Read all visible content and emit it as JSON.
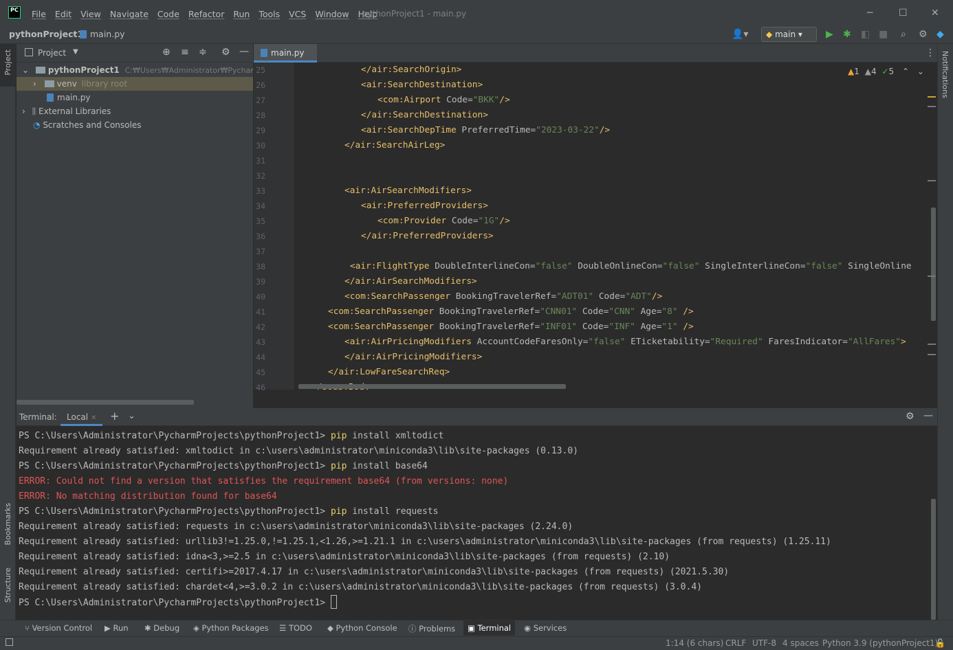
{
  "app": {
    "title": "pythonProject1 - main.py"
  },
  "menu": [
    "File",
    "Edit",
    "View",
    "Navigate",
    "Code",
    "Refactor",
    "Run",
    "Tools",
    "VCS",
    "Window",
    "Help"
  ],
  "breadcrumb": {
    "project": "pythonProject1",
    "file": "main.py"
  },
  "run_config": "main",
  "project_panel": {
    "title": "Project",
    "tree": [
      {
        "label": "pythonProject1",
        "note": "C:₩Users₩Administrator₩PycharmProj"
      },
      {
        "label": "venv",
        "note": "library root"
      },
      {
        "label": "main.py",
        "note": ""
      },
      {
        "label": "External Libraries",
        "note": ""
      },
      {
        "label": "Scratches and Consoles",
        "note": ""
      }
    ]
  },
  "left_strip": {
    "project": "Project",
    "bookmarks": "Bookmarks",
    "structure": "Structure"
  },
  "right_strip": {
    "notifications": "Notifications"
  },
  "editor": {
    "tab": "main.py",
    "inspections": {
      "warn_a": "1",
      "warn_b": "4",
      "ok": "5"
    },
    "lines": [
      {
        "n": "25",
        "indent": 4,
        "parts": [
          [
            "t",
            "</air:SearchOrigin>"
          ]
        ]
      },
      {
        "n": "26",
        "indent": 4,
        "parts": [
          [
            "t",
            "<air:SearchDestination>"
          ]
        ]
      },
      {
        "n": "27",
        "indent": 5,
        "parts": [
          [
            "t",
            "<com:Airport "
          ],
          [
            "a",
            "Code="
          ],
          [
            "v",
            "\"BKK\""
          ],
          [
            "t",
            "/>"
          ]
        ]
      },
      {
        "n": "28",
        "indent": 4,
        "parts": [
          [
            "t",
            "</air:SearchDestination>"
          ]
        ]
      },
      {
        "n": "29",
        "indent": 4,
        "parts": [
          [
            "t",
            "<air:SearchDepTime "
          ],
          [
            "a",
            "PreferredTime="
          ],
          [
            "v",
            "\"2023-03-22\""
          ],
          [
            "t",
            "/>"
          ]
        ]
      },
      {
        "n": "30",
        "indent": 3,
        "parts": [
          [
            "t",
            "</air:SearchAirLeg>"
          ]
        ]
      },
      {
        "n": "31",
        "indent": 0,
        "parts": []
      },
      {
        "n": "32",
        "indent": 0,
        "parts": []
      },
      {
        "n": "33",
        "indent": 3,
        "parts": [
          [
            "t",
            "<air:AirSearchModifiers>"
          ]
        ]
      },
      {
        "n": "34",
        "indent": 4,
        "parts": [
          [
            "t",
            "<air:PreferredProviders>"
          ]
        ]
      },
      {
        "n": "35",
        "indent": 5,
        "parts": [
          [
            "t",
            "<com:Provider "
          ],
          [
            "a",
            "Code="
          ],
          [
            "v",
            "\"1G\""
          ],
          [
            "t",
            "/>"
          ]
        ]
      },
      {
        "n": "36",
        "indent": 4,
        "parts": [
          [
            "t",
            "</air:PreferredProviders>"
          ]
        ]
      },
      {
        "n": "37",
        "indent": 0,
        "parts": []
      },
      {
        "n": "38",
        "indent": 3.33,
        "parts": [
          [
            "t",
            "<air:FlightType "
          ],
          [
            "a",
            "DoubleInterlineCon="
          ],
          [
            "v",
            "\"false\""
          ],
          [
            "a",
            " DoubleOnlineCon="
          ],
          [
            "v",
            "\"false\""
          ],
          [
            "a",
            " SingleInterlineCon="
          ],
          [
            "v",
            "\"false\""
          ],
          [
            "a",
            " SingleOnline"
          ]
        ]
      },
      {
        "n": "39",
        "indent": 3,
        "parts": [
          [
            "t",
            "</air:AirSearchModifiers>"
          ]
        ]
      },
      {
        "n": "40",
        "indent": 3,
        "parts": [
          [
            "t",
            "<com:SearchPassenger "
          ],
          [
            "a",
            "BookingTravelerRef="
          ],
          [
            "v",
            "\"ADT01\""
          ],
          [
            "a",
            " Code="
          ],
          [
            "v",
            "\"ADT\""
          ],
          [
            "t",
            "/>"
          ]
        ]
      },
      {
        "n": "41",
        "indent": 2,
        "parts": [
          [
            "t",
            "<com:SearchPassenger "
          ],
          [
            "a",
            "BookingTravelerRef="
          ],
          [
            "v",
            "\"CNN01\""
          ],
          [
            "a",
            " Code="
          ],
          [
            "v",
            "\"CNN\""
          ],
          [
            "a",
            " Age="
          ],
          [
            "v",
            "\"8\""
          ],
          [
            "t",
            " />"
          ]
        ]
      },
      {
        "n": "42",
        "indent": 2,
        "parts": [
          [
            "t",
            "<com:SearchPassenger "
          ],
          [
            "a",
            "BookingTravelerRef="
          ],
          [
            "v",
            "\"INF01\""
          ],
          [
            "a",
            " Code="
          ],
          [
            "v",
            "\"INF\""
          ],
          [
            "a",
            " Age="
          ],
          [
            "v",
            "\"1\""
          ],
          [
            "t",
            " />"
          ]
        ]
      },
      {
        "n": "43",
        "indent": 3,
        "parts": [
          [
            "t",
            "<air:AirPricingModifiers "
          ],
          [
            "a",
            "AccountCodeFaresOnly="
          ],
          [
            "v",
            "\"false\""
          ],
          [
            "a",
            " ETicketability="
          ],
          [
            "v",
            "\"Required\""
          ],
          [
            "a",
            " FaresIndicator="
          ],
          [
            "v",
            "\"AllFares\""
          ],
          [
            "t",
            ">"
          ]
        ]
      },
      {
        "n": "44",
        "indent": 3,
        "parts": [
          [
            "t",
            "</air:AirPricingModifiers>"
          ]
        ]
      },
      {
        "n": "45",
        "indent": 2,
        "parts": [
          [
            "t",
            "</air:LowFareSearchReq>"
          ]
        ]
      },
      {
        "n": "46",
        "indent": 1,
        "parts": [
          [
            "t",
            "</soap:Body>"
          ]
        ]
      }
    ]
  },
  "terminal": {
    "title": "Terminal:",
    "tab": "Local",
    "lines": [
      {
        "type": "cmd",
        "prompt": "PS C:\\Users\\Administrator\\PycharmProjects\\pythonProject1> ",
        "cmd": "pip",
        "rest": " install xmltodict"
      },
      {
        "type": "out",
        "text": "Requirement already satisfied: xmltodict in c:\\users\\administrator\\miniconda3\\lib\\site-packages (0.13.0)"
      },
      {
        "type": "cmd",
        "prompt": "PS C:\\Users\\Administrator\\PycharmProjects\\pythonProject1> ",
        "cmd": "pip",
        "rest": " install base64"
      },
      {
        "type": "err",
        "text": "ERROR: Could not find a version that satisfies the requirement base64 (from versions: none)"
      },
      {
        "type": "err",
        "text": "ERROR: No matching distribution found for base64"
      },
      {
        "type": "cmd",
        "prompt": "PS C:\\Users\\Administrator\\PycharmProjects\\pythonProject1> ",
        "cmd": "pip",
        "rest": " install requests"
      },
      {
        "type": "out",
        "text": "Requirement already satisfied: requests in c:\\users\\administrator\\miniconda3\\lib\\site-packages (2.24.0)"
      },
      {
        "type": "out",
        "text": "Requirement already satisfied: urllib3!=1.25.0,!=1.25.1,<1.26,>=1.21.1 in c:\\users\\administrator\\miniconda3\\lib\\site-packages (from requests) (1.25.11)"
      },
      {
        "type": "out",
        "text": "Requirement already satisfied: idna<3,>=2.5 in c:\\users\\administrator\\miniconda3\\lib\\site-packages (from requests) (2.10)"
      },
      {
        "type": "out",
        "text": "Requirement already satisfied: certifi>=2017.4.17 in c:\\users\\administrator\\miniconda3\\lib\\site-packages (from requests) (2021.5.30)"
      },
      {
        "type": "out",
        "text": "Requirement already satisfied: chardet<4,>=3.0.2 in c:\\users\\administrator\\miniconda3\\lib\\site-packages (from requests) (3.0.4)"
      },
      {
        "type": "prompt",
        "prompt": "PS C:\\Users\\Administrator\\PycharmProjects\\pythonProject1> "
      }
    ]
  },
  "bottom_tools": [
    "Version Control",
    "Run",
    "Debug",
    "Python Packages",
    "TODO",
    "Python Console",
    "Problems",
    "Terminal",
    "Services"
  ],
  "status": {
    "position": "1:14 (6 chars)",
    "line_sep": "CRLF",
    "encoding": "UTF-8",
    "indent": "4 spaces",
    "interpreter": "Python 3.9 (pythonProject1)"
  },
  "colors": {
    "accent": "#4a88c7",
    "tag": "#e8bf6a",
    "value": "#6a8759",
    "error": "#e05555",
    "command": "#e6d26b",
    "run": "#4fb24f"
  }
}
